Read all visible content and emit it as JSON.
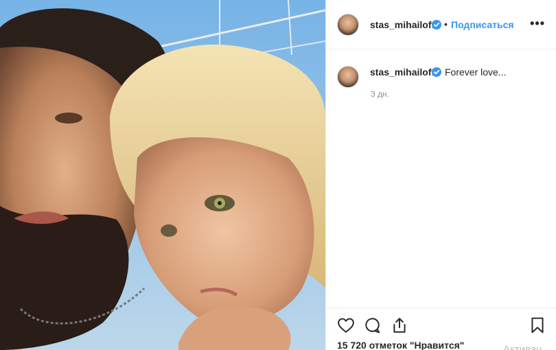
{
  "post": {
    "username": "stas_mihailoff",
    "follow_label": "Подписаться",
    "separator": "•",
    "more_label": "•••",
    "caption": "Forever love...",
    "time_ago": "3 дн.",
    "likes_text": "15 720 отметок \"Нравится\"",
    "verified": true
  },
  "overlay": {
    "watermark": "Активац"
  },
  "icons": {
    "verified": "verified-badge-icon",
    "like": "heart-icon",
    "comment": "comment-bubble-icon",
    "share": "share-upload-icon",
    "save": "bookmark-icon"
  },
  "colors": {
    "accent": "#3897f0",
    "text": "#262626",
    "muted": "#8e8e8e",
    "border": "#efefef"
  }
}
